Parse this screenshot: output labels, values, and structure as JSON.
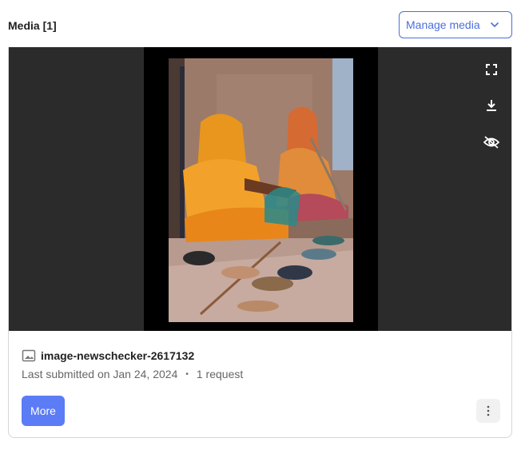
{
  "header": {
    "title": "Media [1]",
    "manage_button_label": "Manage media",
    "manage_button_icon": "chevron-down-icon"
  },
  "viewer": {
    "tools": [
      "fullscreen-icon",
      "download-icon",
      "hide-icon"
    ]
  },
  "media_item": {
    "type_icon": "image-icon",
    "name": "image-newschecker-2617132",
    "last_submitted": "Last submitted on Jan 24, 2024",
    "separator": "•",
    "requests": "1 request"
  },
  "actions": {
    "more_label": "More",
    "menu_icon": "more-vertical-icon"
  },
  "colors": {
    "accent": "#4a6fdc",
    "primary_button": "#5b7cf5",
    "viewer_background": "#2b2b2b"
  }
}
